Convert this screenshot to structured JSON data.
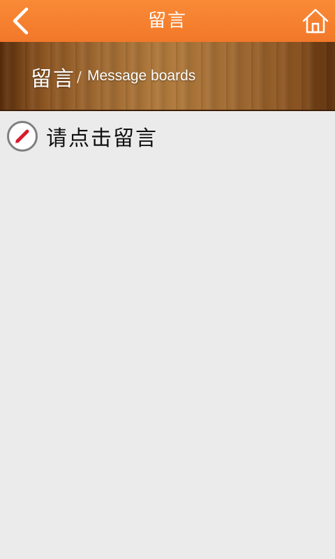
{
  "header": {
    "title": "留言",
    "back_icon": "chevron-left-icon",
    "home_icon": "home-icon",
    "color": "#f2782a"
  },
  "banner": {
    "title": "留言",
    "separator": "/",
    "subtitle": "Message boards"
  },
  "main": {
    "leave_message_label": "请点击留言",
    "leave_message_icon": "pencil-icon",
    "background": "#ebebeb"
  }
}
